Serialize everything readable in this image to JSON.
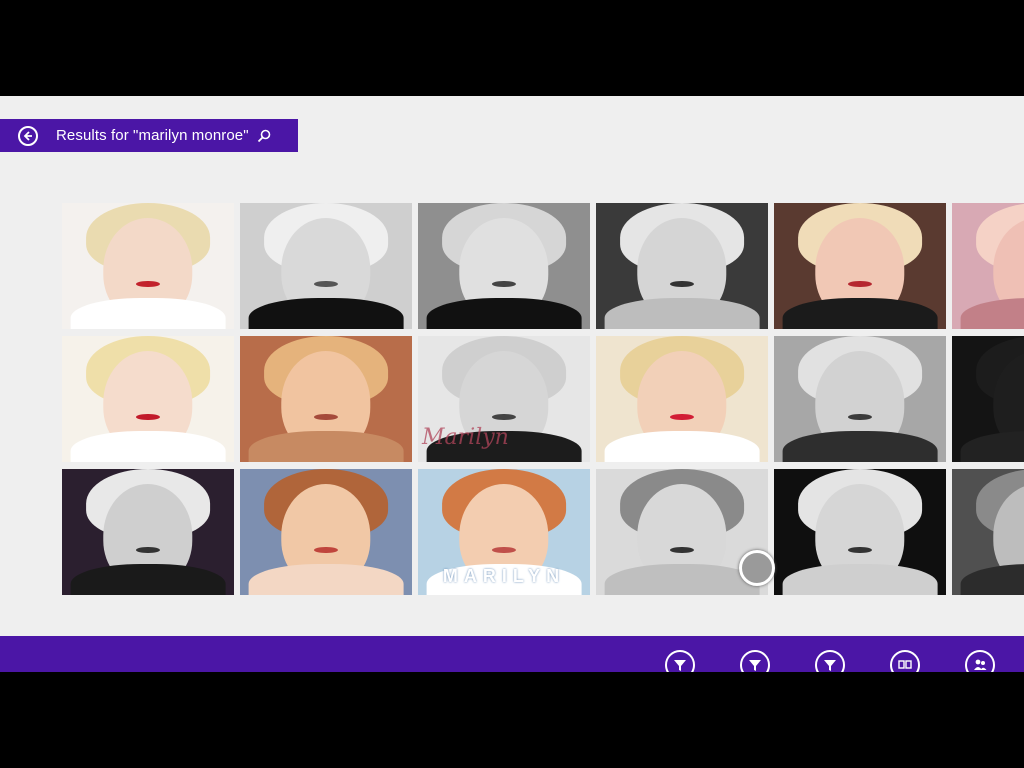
{
  "header": {
    "results_text": "Results for \"marilyn monroe\""
  },
  "grid": {
    "images": [
      {
        "bg": "#f4f1ee",
        "hair": "#eadbb0",
        "face": "#f3d9c8",
        "body": "#ffffff",
        "lips": "#c2222c"
      },
      {
        "bg": "#cfcfcf",
        "hair": "#efefef",
        "face": "#d9d9d9",
        "body": "#111111",
        "lips": "#555555"
      },
      {
        "bg": "#8f8f8f",
        "hair": "#d6d6d6",
        "face": "#e0e0e0",
        "body": "#111111",
        "lips": "#444444"
      },
      {
        "bg": "#3a3a3a",
        "hair": "#e5e5e5",
        "face": "#d5d5d5",
        "body": "#bdbdbd",
        "lips": "#333333"
      },
      {
        "bg": "#5a3a30",
        "hair": "#f0dcb8",
        "face": "#f1c8b5",
        "body": "#1b1b1b",
        "lips": "#b5272f"
      },
      {
        "bg": "#d8a9b4",
        "hair": "#f5d2c6",
        "face": "#efc0b5",
        "body": "#c28088",
        "lips": "#b8303a"
      },
      {
        "bg": "#f6f2ea",
        "hair": "#efdfa9",
        "face": "#f5dccc",
        "body": "#ffffff",
        "lips": "#c21a2a"
      },
      {
        "bg": "#b86d4a",
        "hair": "#e5b37c",
        "face": "#f1c4a0",
        "body": "#c78a62",
        "lips": "#a54a3a"
      },
      {
        "bg": "#e6e6e6",
        "hair": "#cfcfcf",
        "face": "#d6d6d6",
        "body": "#1c1c1c",
        "lips": "#444444"
      },
      {
        "bg": "#efe4cf",
        "hair": "#e8d19a",
        "face": "#f2d0b8",
        "body": "#ffffff",
        "lips": "#d21d35"
      },
      {
        "bg": "#a7a7a7",
        "hair": "#e1e1e1",
        "face": "#d2d2d2",
        "body": "#2e2e2e",
        "lips": "#3b3b3b"
      },
      {
        "bg": "#141414",
        "hair": "#1c1c1c",
        "face": "#1e1e1e",
        "body": "#222222",
        "lips": "#1a1a1a"
      },
      {
        "bg": "#2b1f2f",
        "hair": "#e8e8e8",
        "face": "#cfcfcf",
        "body": "#1a1a1a",
        "lips": "#333333"
      },
      {
        "bg": "#7d8fb0",
        "hair": "#b0653a",
        "face": "#f1c8a6",
        "body": "#f3d7c4",
        "lips": "#c0453c"
      },
      {
        "bg": "#b7d2e4",
        "hair": "#d27a45",
        "face": "#f3cdb0",
        "body": "#ffffff",
        "lips": "#c0504a"
      },
      {
        "bg": "#dadada",
        "hair": "#8a8a8a",
        "face": "#d8d8d8",
        "body": "#bfbfbf",
        "lips": "#333333"
      },
      {
        "bg": "#0f0f0f",
        "hair": "#e4e4e4",
        "face": "#d6d6d6",
        "body": "#cfcfcf",
        "lips": "#333333"
      },
      {
        "bg": "#505050",
        "hair": "#8a8a8a",
        "face": "#bdbdbd",
        "body": "#2c2c2c",
        "lips": "#333333"
      }
    ],
    "overlay_text": "MARILYN",
    "signature_text": "Marilyn"
  },
  "app_bar": {
    "buttons": [
      {
        "icon": "filter-icon"
      },
      {
        "icon": "filter-icon"
      },
      {
        "icon": "filter-icon"
      },
      {
        "icon": "slideshow-icon"
      },
      {
        "icon": "people-icon"
      }
    ]
  },
  "colors": {
    "accent": "#4b16a6",
    "page_background": "#efefef",
    "letterbox": "#000000"
  }
}
